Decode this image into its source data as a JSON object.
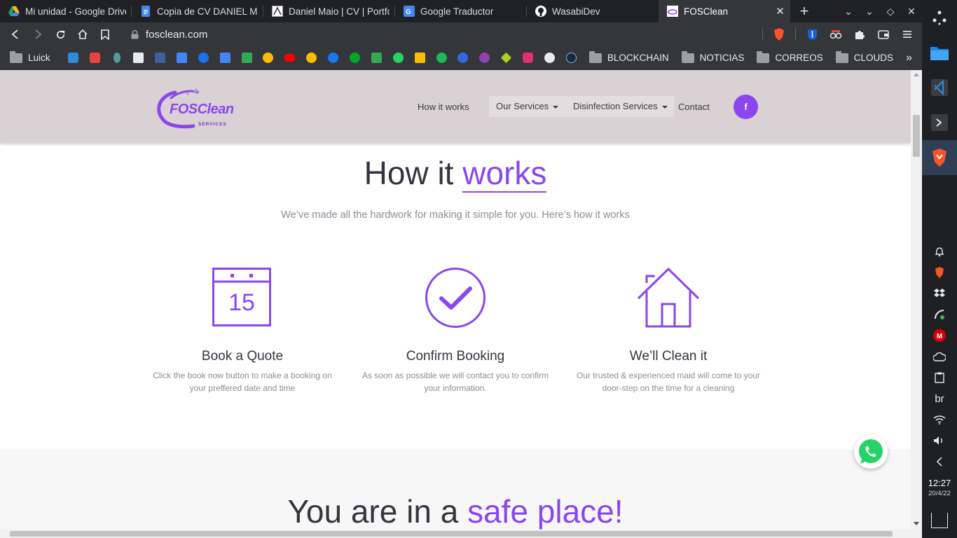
{
  "browser": {
    "tabs": [
      {
        "title": "Mi unidad - Google Drive",
        "icon": "google-drive-icon",
        "active": false
      },
      {
        "title": "Copia de CV DANIEL MAIO",
        "icon": "google-docs-icon",
        "active": false
      },
      {
        "title": "Daniel Maio | CV | Portfolio",
        "icon": "portfolio-icon",
        "active": false
      },
      {
        "title": "Google Traductor",
        "icon": "google-translate-icon",
        "active": false
      },
      {
        "title": "WasabiDev",
        "icon": "github-icon",
        "active": false
      },
      {
        "title": "FOSClean",
        "icon": "fosclean-icon",
        "active": true
      }
    ],
    "new_tab_label": "+",
    "url": "fosclean.com",
    "bookmarks": {
      "first_folder": "Luick",
      "app_icons": [
        "vscode-icon",
        "brave-icon",
        "ethereum-icon",
        "notes-icon",
        "jw-icon",
        "translate-icon",
        "contacts-icon",
        "calendar-icon",
        "play-store-icon",
        "maps-icon",
        "youtube-icon",
        "photos-icon",
        "facebook-icon",
        "evernote-icon",
        "drive-icon",
        "whatsapp-icon",
        "keep-icon",
        "spotify-icon",
        "app-icon",
        "vpn-icon",
        "figma-icon",
        "instagram-icon",
        "github-icon",
        "steam-icon"
      ],
      "folders": [
        "BLOCKCHAIN",
        "NOTICIAS",
        "CORREOS",
        "CLOUDS"
      ],
      "more": "»"
    }
  },
  "site": {
    "logo_text": "FOSClean",
    "logo_sub": "SERVICES",
    "nav": {
      "how_it_works": "How it works",
      "our_services": "Our Services",
      "disinfection_services": "Disinfection Services",
      "contact": "Contact",
      "facebook": "f"
    },
    "how": {
      "title_plain": "How it ",
      "title_accent": "works",
      "subtitle": "We’ve made all the hardwork for making it simple for you. Here’s how it works",
      "steps": [
        {
          "icon": "calendar-icon",
          "calendar_day": "15",
          "title": "Book a Quote",
          "desc": "Click the book now button to make a booking on your preffered date and time"
        },
        {
          "icon": "check-circle-icon",
          "title": "Confirm Booking",
          "desc": "As soon as possible we will contact you to confirm your information."
        },
        {
          "icon": "house-icon",
          "title": "We’ll Clean it",
          "desc": "Our trusted & experienced maid will come to your door-step on the time for a cleaning"
        }
      ]
    },
    "safe": {
      "title_plain": "You are in a ",
      "title_accent": "safe place!"
    }
  },
  "os": {
    "keyboard_layout": "br",
    "time": "12:27",
    "date": "20/4/22"
  },
  "colors": {
    "accent": "#8b46ee",
    "header_bg": "#dad1d4",
    "text_dark": "#35353f",
    "text_muted": "#8c8c97",
    "whatsapp": "#25d366"
  }
}
